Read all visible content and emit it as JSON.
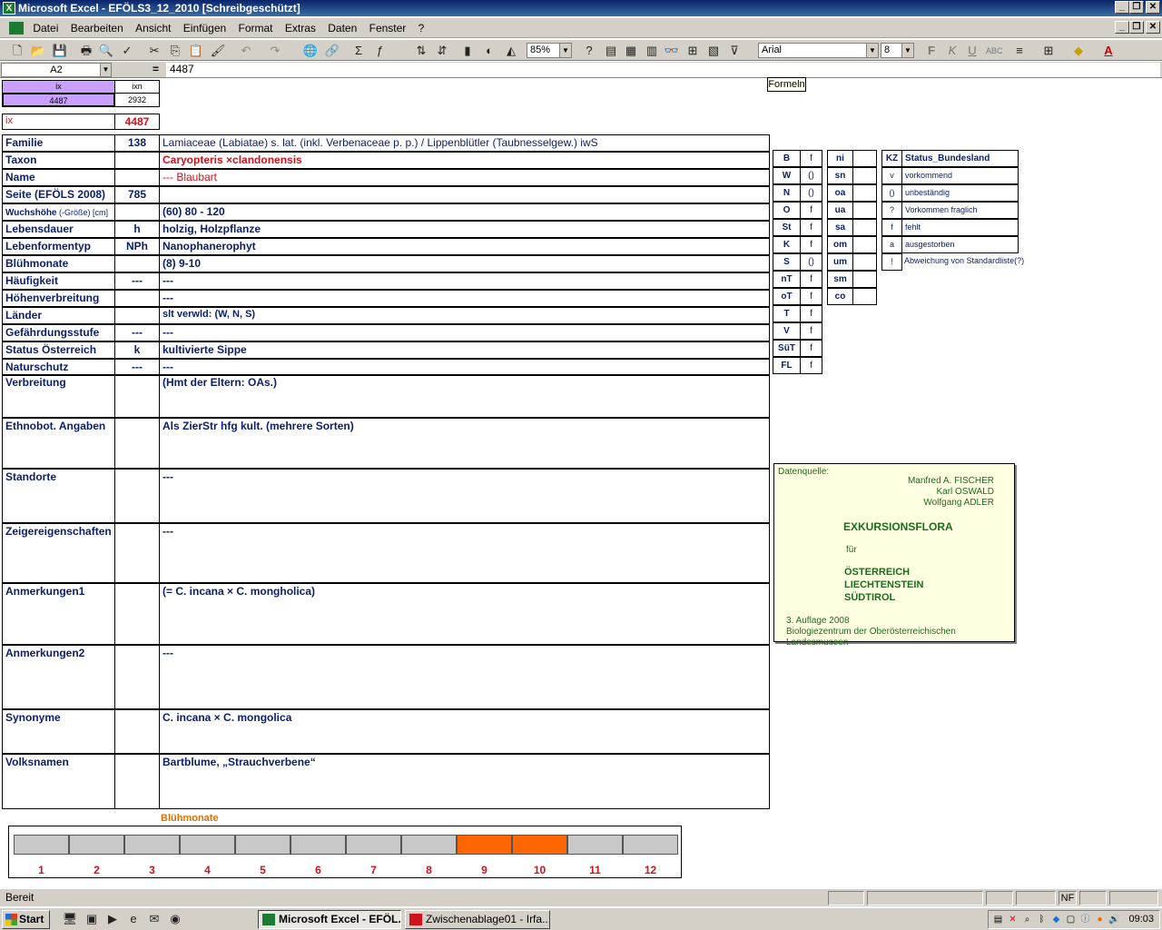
{
  "window": {
    "title": "Microsoft Excel - EFÖLS3_12_2010  [Schreibgeschützt]",
    "btn_min": "_",
    "btn_max": "❐",
    "btn_close": "✕",
    "excel_letter": "X"
  },
  "menu": [
    "Datei",
    "Bearbeiten",
    "Ansicht",
    "Einfügen",
    "Format",
    "Extras",
    "Daten",
    "Fenster",
    "?"
  ],
  "toolbar": {
    "zoom": "85%",
    "font": "Arial",
    "font_size": "8",
    "bold": "F",
    "italic": "K",
    "underline": "U"
  },
  "formula_bar": {
    "cell_ref": "A2",
    "equals": "=",
    "value": "4487",
    "tooltip": "Formeln"
  },
  "header_cells": {
    "ix_label": "ix",
    "ixn_label": "ixn",
    "ix_value": "4487",
    "ixn_value": "2932"
  },
  "ix_row": {
    "label": "ix",
    "value": "4487"
  },
  "rows": [
    {
      "label": "Familie",
      "code": "138",
      "value": "Lamiaceae (Labiatae) s. lat. (inkl. Verbenaceae p. p.)  /  Lippenblütler (Taubnesselgew.) iwS"
    },
    {
      "label": "Taxon",
      "code": "",
      "value": "Caryopteris ×clandonensis"
    },
    {
      "label": "Name",
      "code": "",
      "value": "--- Blaubart"
    },
    {
      "label": "Seite (EFÖLS 2008)",
      "code": "785",
      "value": ""
    },
    {
      "label": "Wuchshöhe",
      "label_suffix": " (-Größe) [cm]",
      "code": "",
      "value": " (60) 80 - 120"
    },
    {
      "label": "Lebensdauer",
      "code": "h",
      "value": "holzig, Holzpflanze"
    },
    {
      "label": "Lebenformentyp",
      "code": "NPh",
      "value": "Nanophanerophyt"
    },
    {
      "label": "Blühmonate",
      "code": "",
      "value": "(8) 9-10"
    },
    {
      "label": "Häufigkeit",
      "code": "---",
      "value": " ---"
    },
    {
      "label": "Höhenverbreitung",
      "code": "",
      "value": " ---"
    },
    {
      "label": "Länder",
      "code": "",
      "value": "slt verwld: (W, N, S)"
    },
    {
      "label": "Gefährdungsstufe",
      "code": "---",
      "value": "  ---"
    },
    {
      "label": "Status Österreich",
      "code": "k",
      "value": "kultivierte Sippe"
    },
    {
      "label": "Naturschutz",
      "code": "---",
      "value": " ---"
    },
    {
      "label": "Verbreitung",
      "code": "",
      "value": "(Hmt der Eltern: OAs.)"
    },
    {
      "label": "Ethnobot. Angaben",
      "code": "",
      "value": "Als ZierStr hfg kult. (mehrere Sorten)"
    },
    {
      "label": "Standorte",
      "code": "",
      "value": "---"
    },
    {
      "label": "Zeigereigenschaften",
      "code": "",
      "value": "---"
    },
    {
      "label": "Anmerkungen1",
      "code": "",
      "value": "(= C. incana × C. mongholica)"
    },
    {
      "label": "Anmerkungen2",
      "code": "",
      "value": "---"
    },
    {
      "label": "Synonyme",
      "code": "",
      "value": "C. incana × C. mongolica"
    },
    {
      "label": "Volksnamen",
      "code": "",
      "value": "Bartblume, „Strauchverbene“"
    }
  ],
  "state_table1": [
    {
      "k": "B",
      "v": "f"
    },
    {
      "k": "W",
      "v": "()"
    },
    {
      "k": "N",
      "v": "()"
    },
    {
      "k": "O",
      "v": "f"
    },
    {
      "k": "St",
      "v": "f"
    },
    {
      "k": "K",
      "v": "f"
    },
    {
      "k": "S",
      "v": "()"
    },
    {
      "k": "nT",
      "v": "f"
    },
    {
      "k": "oT",
      "v": "f"
    },
    {
      "k": "T",
      "v": "f"
    },
    {
      "k": "V",
      "v": "f"
    },
    {
      "k": "SüT",
      "v": "f"
    },
    {
      "k": "FL",
      "v": "f"
    }
  ],
  "state_table2": [
    {
      "k": "ni",
      "v": ""
    },
    {
      "k": "sn",
      "v": ""
    },
    {
      "k": "oa",
      "v": ""
    },
    {
      "k": "ua",
      "v": ""
    },
    {
      "k": "sa",
      "v": ""
    },
    {
      "k": "om",
      "v": ""
    },
    {
      "k": "um",
      "v": ""
    },
    {
      "k": "sm",
      "v": ""
    },
    {
      "k": "co",
      "v": ""
    }
  ],
  "legend": {
    "header_kz": "KZ",
    "header_status": "Status_Bundesland",
    "items": [
      {
        "k": "v",
        "v": "vorkommend"
      },
      {
        "k": "()",
        "v": "unbeständig"
      },
      {
        "k": "?",
        "v": "Vorkommen fraglich"
      },
      {
        "k": "f",
        "v": "fehlt"
      },
      {
        "k": "a",
        "v": "ausgestorben"
      },
      {
        "k": "!",
        "v": "Abweichung von Standardliste(?)"
      }
    ]
  },
  "datasource": {
    "label": "Datenquelle:",
    "authors": [
      "Manfred A. FISCHER",
      "Karl OSWALD",
      "Wolfgang ADLER"
    ],
    "title": "EXKURSIONSFLORA",
    "fuer": "für",
    "countries": [
      "ÖSTERREICH",
      "LIECHTENSTEIN",
      "SÜDTIROL"
    ],
    "edition": "3. Auflage 2008",
    "publisher": "Biologiezentrum der Oberösterreichischen Landesmuseen"
  },
  "bloom_chart": {
    "title": "Blühmonate",
    "months": [
      "1",
      "2",
      "3",
      "4",
      "5",
      "6",
      "7",
      "8",
      "9",
      "10",
      "11",
      "12"
    ],
    "active": [
      false,
      false,
      false,
      false,
      false,
      false,
      false,
      false,
      true,
      true,
      false,
      false
    ],
    "active_color": "#ff6600",
    "inactive_color": "#c8c8c8"
  },
  "statusbar": {
    "text": "Bereit",
    "nf": "NF"
  },
  "taskbar": {
    "start": "Start",
    "tasks": [
      "Microsoft Excel - EFÖL...",
      "Zwischenablage01 - Irfa..."
    ],
    "clock": "09:03"
  }
}
